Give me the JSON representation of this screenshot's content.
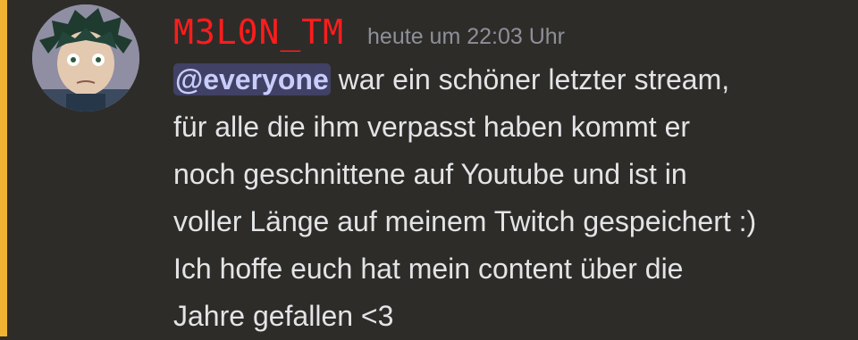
{
  "message": {
    "author": "M3L0N_TM",
    "author_color": "#ff1c1c",
    "timestamp": "heute um 22:03 Uhr",
    "mention": "@everyone",
    "mention_highlight_color": "#f0b232",
    "lines": [
      " war ein schöner letzter stream,",
      "für alle die ihm verpasst haben kommt er",
      "noch geschnittene auf Youtube und ist in",
      "voller Länge auf meinem Twitch gespeichert :)",
      "Ich hoffe euch hat mein content über die",
      "Jahre gefallen <3"
    ]
  }
}
